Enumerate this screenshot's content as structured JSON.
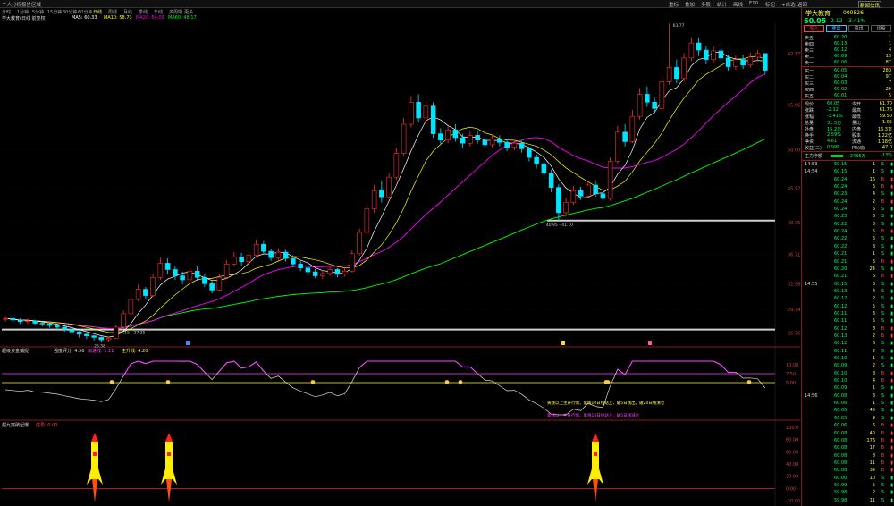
{
  "topbar": {
    "left": "个人分析报告区域",
    "menus": [
      "重标",
      "叠加",
      "多股",
      "统计",
      "画线",
      "F10",
      "标记",
      "+自选",
      "返回"
    ],
    "right_badge": "新闻快讯"
  },
  "periods": [
    "分时",
    "1分钟",
    "5分钟",
    "15分钟",
    "30分钟",
    "60分钟",
    "日线",
    "周线",
    "月线",
    "季线",
    "年线",
    "多周期",
    "更多"
  ],
  "active_period": "日线",
  "infobar": {
    "stock": "学大教育(日线 前复权)",
    "ma_items": [
      {
        "label": "MA5",
        "value": "60.33",
        "color": "#ffffff"
      },
      {
        "label": "MA10",
        "value": "58.73",
        "color": "#ffff00"
      },
      {
        "label": "MA20",
        "value": "54.09",
        "color": "#ff00ff"
      },
      {
        "label": "MA60",
        "value": "48.17",
        "color": "#00ff00"
      }
    ]
  },
  "main_chart": {
    "y_ticks": [
      "62.17",
      "55.66",
      "50.00",
      "45.12",
      "40.76",
      "36.71",
      "32.98",
      "29.74",
      "26.76"
    ],
    "high_label": "63.77",
    "low_label1": "25.58",
    "low_label2": "40.95 - 41.10",
    "low_label3": "27.15 - 27.35"
  },
  "ind1": {
    "title": "超级资金捕捉",
    "params": [
      {
        "text": "强度评分: 4.36",
        "color": "#e0e0e0"
      },
      {
        "text": "加速线: 1.11",
        "color": "#ff40ff"
      },
      {
        "text": "主升线: 4.20",
        "color": "#ffff00"
      }
    ],
    "y_ticks": [
      "10.00",
      "7.50",
      "5.00"
    ],
    "notes": [
      {
        "text": "黄线以上主升行情，紫线10日线站上，破5日线出，破20日线清仓",
        "color": "#ffff40"
      },
      {
        "text": "紫线以上主升行情，紫线10日线站上，破5日线减仓",
        "color": "#ff40ff"
      }
    ]
  },
  "ind2": {
    "title": "超九突破起爆",
    "param": "信号: 0.00",
    "y_ticks": [
      "100.0",
      "80.00",
      "60.00",
      "40.00",
      "20.00",
      "0.00",
      "-20.00"
    ]
  },
  "side": {
    "name": "学大教育",
    "code": "000526",
    "price": "60.05",
    "change": "-2.12",
    "pct": "-3.41%",
    "buttons": [
      "买入",
      "卖出",
      "资讯",
      "诊股"
    ],
    "asks": [
      {
        "label": "卖五",
        "price": "60.20",
        "vol": "1"
      },
      {
        "label": "卖四",
        "price": "60.13",
        "vol": "1"
      },
      {
        "label": "卖三",
        "price": "60.12",
        "vol": "4"
      },
      {
        "label": "卖二",
        "price": "60.09",
        "vol": "13"
      },
      {
        "label": "卖一",
        "price": "60.06",
        "vol": "87"
      }
    ],
    "bids": [
      {
        "label": "买一",
        "price": "60.05",
        "vol": "283"
      },
      {
        "label": "买二",
        "price": "60.04",
        "vol": "97"
      },
      {
        "label": "买三",
        "price": "60.03",
        "vol": "7"
      },
      {
        "label": "买四",
        "price": "60.02",
        "vol": "29"
      },
      {
        "label": "买五",
        "price": "60.01",
        "vol": "5"
      }
    ],
    "stats": [
      [
        "现价",
        "60.05",
        "今开",
        "61.70"
      ],
      [
        "涨跌",
        "-2.12",
        "最高",
        "61.76"
      ],
      [
        "涨幅",
        "-3.41%",
        "最低",
        "59.50"
      ],
      [
        "总量",
        "31.5万",
        "量比",
        "1.05"
      ],
      [
        "外盘",
        "15.2万",
        "内盘",
        "16.3万"
      ]
    ],
    "extra": [
      [
        "换手",
        "2.59%",
        "股本",
        "1.22亿"
      ],
      [
        "净资",
        "4.61",
        "流通",
        "1.18亿"
      ],
      [
        "收益(三)",
        "0.998",
        "PE(动)",
        "47.0"
      ]
    ],
    "flow_label": "主力净额",
    "flow_value": "-2436万",
    "flow_pct": "-13%",
    "ticks": [
      {
        "time": "14:53",
        "price": "60.15",
        "vol": "1",
        "dir": "S"
      },
      {
        "time": "14:54",
        "price": "60.15",
        "vol": "1",
        "dir": "S"
      },
      {
        "time": "",
        "price": "60.24",
        "vol": "16",
        "dir": "B"
      },
      {
        "time": "",
        "price": "60.24",
        "vol": "6",
        "dir": "B"
      },
      {
        "time": "",
        "price": "60.23",
        "vol": "4",
        "dir": "S"
      },
      {
        "time": "",
        "price": "60.24",
        "vol": "2",
        "dir": "B"
      },
      {
        "time": "",
        "price": "60.24",
        "vol": "6",
        "dir": "S"
      },
      {
        "time": "",
        "price": "60.23",
        "vol": "3",
        "dir": "S"
      },
      {
        "time": "",
        "price": "60.22",
        "vol": "8",
        "dir": "S"
      },
      {
        "time": "",
        "price": "60.24",
        "vol": "5",
        "dir": "B"
      },
      {
        "time": "",
        "price": "60.22",
        "vol": "6",
        "dir": "S"
      },
      {
        "time": "",
        "price": "60.22",
        "vol": "3",
        "dir": "S"
      },
      {
        "time": "",
        "price": "60.21",
        "vol": "1",
        "dir": "S"
      },
      {
        "time": "",
        "price": "60.21",
        "vol": "6",
        "dir": "B"
      },
      {
        "time": "",
        "price": "60.20",
        "vol": "24",
        "dir": "S"
      },
      {
        "time": "",
        "price": "60.21",
        "vol": "6",
        "dir": "B"
      },
      {
        "time": "14:55",
        "price": "60.15",
        "vol": "3",
        "dir": "S"
      },
      {
        "time": "",
        "price": "60.13",
        "vol": "4",
        "dir": "S"
      },
      {
        "time": "",
        "price": "60.12",
        "vol": "2",
        "dir": "S"
      },
      {
        "time": "",
        "price": "60.12",
        "vol": "5",
        "dir": "S"
      },
      {
        "time": "",
        "price": "60.11",
        "vol": "3",
        "dir": "S"
      },
      {
        "time": "",
        "price": "60.11",
        "vol": "5",
        "dir": "S"
      },
      {
        "time": "",
        "price": "60.12",
        "vol": "8",
        "dir": "B"
      },
      {
        "time": "",
        "price": "60.13",
        "vol": "2",
        "dir": "B"
      },
      {
        "time": "",
        "price": "60.12",
        "vol": "6",
        "dir": "S"
      },
      {
        "time": "",
        "price": "60.11",
        "vol": "2",
        "dir": "S"
      },
      {
        "time": "",
        "price": "60.10",
        "vol": "1",
        "dir": "S"
      },
      {
        "time": "",
        "price": "60.09",
        "vol": "2",
        "dir": "S"
      },
      {
        "time": "",
        "price": "60.10",
        "vol": "8",
        "dir": "B"
      },
      {
        "time": "",
        "price": "60.10",
        "vol": "4",
        "dir": "B"
      },
      {
        "time": "",
        "price": "60.09",
        "vol": "1",
        "dir": "S"
      },
      {
        "time": "14:56",
        "price": "60.08",
        "vol": "3",
        "dir": "S"
      },
      {
        "time": "",
        "price": "60.06",
        "vol": "1",
        "dir": "S"
      },
      {
        "time": "",
        "price": "60.05",
        "vol": "45",
        "dir": "S"
      },
      {
        "time": "",
        "price": "60.05",
        "vol": "9",
        "dir": "S"
      },
      {
        "time": "",
        "price": "60.06",
        "vol": "6",
        "dir": "B"
      },
      {
        "time": "",
        "price": "60.08",
        "vol": "40",
        "dir": "B"
      },
      {
        "time": "",
        "price": "60.08",
        "vol": "176",
        "dir": "B"
      },
      {
        "time": "",
        "price": "60.08",
        "vol": "17",
        "dir": "B"
      },
      {
        "time": "",
        "price": "60.08",
        "vol": "8",
        "dir": "B"
      },
      {
        "time": "",
        "price": "60.08",
        "vol": "11",
        "dir": "B"
      },
      {
        "time": "",
        "price": "60.08",
        "vol": "34",
        "dir": "B"
      },
      {
        "time": "",
        "price": "60.00",
        "vol": "10",
        "dir": "S"
      },
      {
        "time": "",
        "price": "59.99",
        "vol": "5",
        "dir": "S"
      },
      {
        "time": "",
        "price": "59.98",
        "vol": "2",
        "dir": "S"
      },
      {
        "time": "",
        "price": "59.98",
        "vol": "11",
        "dir": "S"
      }
    ]
  },
  "colors": {
    "up": "#ff3030",
    "down": "#00e5ff",
    "ma5": "#ffffff",
    "ma10": "#ffff00",
    "ma20": "#ff00ff",
    "ma60": "#00ff00",
    "frame": "#8a1a1a"
  },
  "chart_data": {
    "type": "candlestick",
    "price_range": [
      25,
      66
    ],
    "candles": [
      [
        28.5,
        28.6,
        28.8,
        28.2
      ],
      [
        28.6,
        28.4,
        28.9,
        28.2
      ],
      [
        28.4,
        28.2,
        28.6,
        27.9
      ],
      [
        28.2,
        28.3,
        28.6,
        27.9
      ],
      [
        28.3,
        28.0,
        28.4,
        27.8
      ],
      [
        28.0,
        27.9,
        28.2,
        27.6
      ],
      [
        27.9,
        27.7,
        28.0,
        27.4
      ],
      [
        27.7,
        27.5,
        27.9,
        27.2
      ],
      [
        27.5,
        27.2,
        27.6,
        26.9
      ],
      [
        27.2,
        26.9,
        27.3,
        26.6
      ],
      [
        26.9,
        26.6,
        27.0,
        26.2
      ],
      [
        26.6,
        26.4,
        26.8,
        26.0
      ],
      [
        26.4,
        26.2,
        26.5,
        25.8
      ],
      [
        26.2,
        25.9,
        26.3,
        25.6
      ],
      [
        25.9,
        26.1,
        26.3,
        25.6
      ],
      [
        26.1,
        27.5,
        27.8,
        26.0
      ],
      [
        27.5,
        29.2,
        29.6,
        27.3
      ],
      [
        29.2,
        31.0,
        31.5,
        29.0
      ],
      [
        31.0,
        32.3,
        32.9,
        30.8
      ],
      [
        32.3,
        31.5,
        32.6,
        31.0
      ],
      [
        31.5,
        33.8,
        34.3,
        31.3
      ],
      [
        33.8,
        35.6,
        36.3,
        33.5
      ],
      [
        35.6,
        34.8,
        36.2,
        34.2
      ],
      [
        34.8,
        34.0,
        35.3,
        33.5
      ],
      [
        34.0,
        33.5,
        34.5,
        32.9
      ],
      [
        33.5,
        34.6,
        35.0,
        33.2
      ],
      [
        34.6,
        33.8,
        35.2,
        33.4
      ],
      [
        33.8,
        33.0,
        34.2,
        32.6
      ],
      [
        33.0,
        32.2,
        33.4,
        31.8
      ],
      [
        32.2,
        33.8,
        34.2,
        32.0
      ],
      [
        33.8,
        35.5,
        36.0,
        33.6
      ],
      [
        35.5,
        36.4,
        37.0,
        35.2
      ],
      [
        36.4,
        35.8,
        36.9,
        35.3
      ],
      [
        35.8,
        36.6,
        37.1,
        35.4
      ],
      [
        36.6,
        38.0,
        38.6,
        36.3
      ],
      [
        38.0,
        37.1,
        38.4,
        36.7
      ],
      [
        37.1,
        36.3,
        37.4,
        35.9
      ],
      [
        36.3,
        37.0,
        37.5,
        36.0
      ],
      [
        37.0,
        36.2,
        37.3,
        35.8
      ],
      [
        36.2,
        35.5,
        36.6,
        35.1
      ],
      [
        35.5,
        35.0,
        35.9,
        34.6
      ],
      [
        35.0,
        34.5,
        35.3,
        34.1
      ],
      [
        34.5,
        34.0,
        34.9,
        33.7
      ],
      [
        34.0,
        34.3,
        34.7,
        33.6
      ],
      [
        34.3,
        34.8,
        35.2,
        34.0
      ],
      [
        34.8,
        34.2,
        35.0,
        33.8
      ],
      [
        34.2,
        34.6,
        35.0,
        33.9
      ],
      [
        34.6,
        36.8,
        37.2,
        34.4
      ],
      [
        36.8,
        39.5,
        40.0,
        36.6
      ],
      [
        39.5,
        42.5,
        43.0,
        39.2
      ],
      [
        42.5,
        44.8,
        45.5,
        42.0
      ],
      [
        44.8,
        44.0,
        46.0,
        43.3
      ],
      [
        44.0,
        46.5,
        47.0,
        43.8
      ],
      [
        46.5,
        49.5,
        50.2,
        46.2
      ],
      [
        49.5,
        53.2,
        54.0,
        49.2
      ],
      [
        53.2,
        56.0,
        56.8,
        52.8
      ],
      [
        56.0,
        54.0,
        57.0,
        53.5
      ],
      [
        54.0,
        55.5,
        56.2,
        53.2
      ],
      [
        55.5,
        52.0,
        56.0,
        51.5
      ],
      [
        52.0,
        51.2,
        52.7,
        50.6
      ],
      [
        51.2,
        52.5,
        53.0,
        50.8
      ],
      [
        52.5,
        51.5,
        53.2,
        51.0
      ],
      [
        51.5,
        50.8,
        52.0,
        50.2
      ],
      [
        50.8,
        51.8,
        52.3,
        50.4
      ],
      [
        51.8,
        51.2,
        52.4,
        50.7
      ],
      [
        51.2,
        50.6,
        51.7,
        50.1
      ],
      [
        50.6,
        51.3,
        51.9,
        50.2
      ],
      [
        51.3,
        50.9,
        51.8,
        50.4
      ],
      [
        50.9,
        50.3,
        51.3,
        49.8
      ],
      [
        50.3,
        50.8,
        51.2,
        49.9
      ],
      [
        50.8,
        50.1,
        51.1,
        49.6
      ],
      [
        50.1,
        49.0,
        50.4,
        48.5
      ],
      [
        49.0,
        48.2,
        49.4,
        47.6
      ],
      [
        48.2,
        47.0,
        48.5,
        46.4
      ],
      [
        47.0,
        45.2,
        47.4,
        44.6
      ],
      [
        45.2,
        42.0,
        45.6,
        40.95
      ],
      [
        42.0,
        43.3,
        43.9,
        41.5
      ],
      [
        43.3,
        44.8,
        45.4,
        43.0
      ],
      [
        44.8,
        44.1,
        45.3,
        43.6
      ],
      [
        44.1,
        45.5,
        46.0,
        43.8
      ],
      [
        45.5,
        44.4,
        46.1,
        44.0
      ],
      [
        44.4,
        43.8,
        44.9,
        43.2
      ],
      [
        43.8,
        48.5,
        49.0,
        43.5
      ],
      [
        48.5,
        52.2,
        53.0,
        48.2
      ],
      [
        52.2,
        51.0,
        53.2,
        50.4
      ],
      [
        51.0,
        54.2,
        55.0,
        50.8
      ],
      [
        54.2,
        57.0,
        57.8,
        53.8
      ],
      [
        57.0,
        56.0,
        58.0,
        55.4
      ],
      [
        56.0,
        55.2,
        56.6,
        54.6
      ],
      [
        55.2,
        58.6,
        59.3,
        54.9
      ],
      [
        58.6,
        60.4,
        66.0,
        58.2
      ],
      [
        60.4,
        59.0,
        61.4,
        58.4
      ],
      [
        59.0,
        61.6,
        62.2,
        58.6
      ],
      [
        61.6,
        63.5,
        64.2,
        61.2
      ],
      [
        63.5,
        62.6,
        64.2,
        61.8
      ],
      [
        62.6,
        61.4,
        63.1,
        60.8
      ],
      [
        61.4,
        62.5,
        63.1,
        61.0
      ],
      [
        62.5,
        61.6,
        63.0,
        61.0
      ],
      [
        61.6,
        60.5,
        62.0,
        60.0
      ],
      [
        60.5,
        61.4,
        61.9,
        60.1
      ],
      [
        61.4,
        60.7,
        62.0,
        60.2
      ],
      [
        60.7,
        61.7,
        62.3,
        60.4
      ],
      [
        61.7,
        62.17,
        62.6,
        61.2
      ],
      [
        62.17,
        60.05,
        61.76,
        59.5
      ]
    ]
  }
}
